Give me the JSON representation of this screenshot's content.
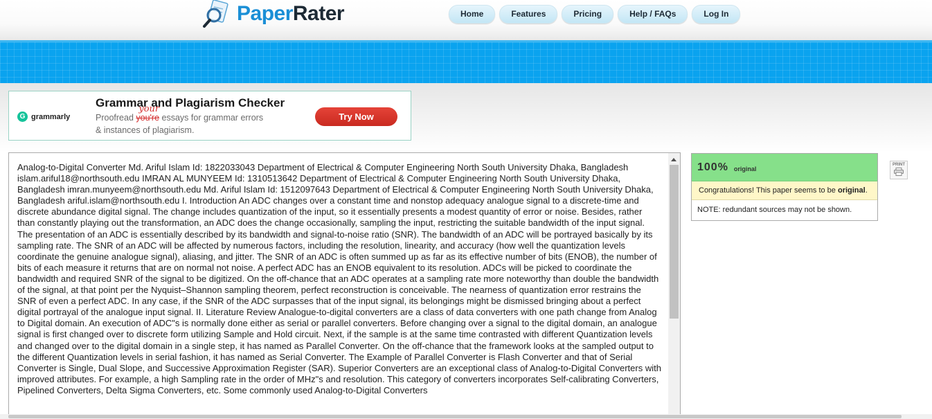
{
  "brand": {
    "name_part1": "Paper",
    "name_part2": "Rater"
  },
  "nav": {
    "home": "Home",
    "features": "Features",
    "pricing": "Pricing",
    "help": "Help / FAQs",
    "login": "Log In"
  },
  "ad": {
    "brand": "grammarly",
    "title": "Grammar and Plagiarism Checker",
    "line1_prefix": "Proofread",
    "struck": "you're",
    "correction": "your",
    "line1_suffix": "essays for grammar errors",
    "line2": "& instances of plagiarism.",
    "cta": "Try Now"
  },
  "paper_text": "Analog-to-Digital Converter Md. Ariful Islam Id: 1822033043 Department of Electrical & Computer Engineering North South University Dhaka, Bangladesh islam.ariful18@northsouth.edu IMRAN AL MUNYEEM Id: 1310513642 Department of Electrical & Computer Engineering North South University Dhaka, Bangladesh imran.munyeem@northsouth.edu Md. Ariful Islam Id: 1512097643 Department of Electrical & Computer Engineering North South University Dhaka, Bangladesh ariful.islam@northsouth.edu I. Introduction An ADC changes over a constant time and nonstop adequacy analogue signal to a discrete-time and discrete abundance digital signal. The change includes quantization of the input, so it essentially presents a modest quantity of error or noise. Besides, rather than constantly playing out the transformation, an ADC does the change occasionally, sampling the input, restricting the suitable bandwidth of the input signal. The presentation of an ADC is essentially described by its bandwidth and signal-to-noise ratio (SNR). The bandwidth of an ADC will be portrayed basically by its sampling rate. The SNR of an ADC will be affected by numerous factors, including the resolution, linearity, and accuracy (how well the quantization levels coordinate the genuine analogue signal), aliasing, and jitter. The SNR of an ADC is often summed up as far as its effective number of bits (ENOB), the number of bits of each measure it returns that are on normal not noise. A perfect ADC has an ENOB equivalent to its resolution. ADCs will be picked to coordinate the bandwidth and required SNR of the signal to be digitized. On the off-chance that an ADC operates at a sampling rate more noteworthy than double the bandwidth of the signal, at that point per the Nyquist–Shannon sampling theorem, perfect reconstruction is conceivable. The nearness of quantization error restrains the SNR of even a perfect ADC. In any case, if the SNR of the ADC surpasses that of the input signal, its belongings might be dismissed bringing about a perfect digital portrayal of the analogue input signal. II. Literature Review Analogue-to-digital converters are a class of data converters with one path change from Analog to Digital domain. An execution of ADC\"s is normally done either as serial or parallel converters. Before changing over a signal to the digital domain, an analogue signal is first changed over to discrete form utilizing Sample and Hold circuit. Next, if the sample is at the same time contrasted with different Quantization levels and changed over to the digital domain in a single step, it has named as Parallel Converter. On the off-chance that the framework looks at the sampled output to the different Quantization levels in serial fashion, it has named as Serial Converter. The Example of Parallel Converter is Flash Converter and that of Serial Converter is Single, Dual Slope, and Successive Approximation Register (SAR). Superior Converters are an exceptional class of Analog-to-Digital Converters with improved attributes. For example, a high Sampling rate in the order of MHz\"s and resolution. This category of converters incorporates Self-calibrating Converters, Pipelined Converters, Delta Sigma Converters, etc. Some commonly used Analog-to-Digital Converters",
  "result": {
    "percent": "100%",
    "label": "original",
    "congrats_prefix": "Congratulations! This paper seems to be ",
    "congrats_bold": "original",
    "congrats_suffix": ".",
    "note": "NOTE: redundant sources may not be shown."
  },
  "print_label": "PRINT",
  "colors": {
    "brand_blue": "#1b8fd6",
    "band_blue": "#0aa3ef",
    "success_green": "#86e08a",
    "cta_red": "#d9372c"
  }
}
